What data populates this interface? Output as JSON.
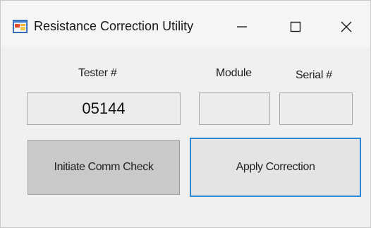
{
  "window": {
    "title": "Resistance Correction Utility",
    "icon": "app-form-icon",
    "controls": {
      "minimize_icon": "minimize-icon",
      "maximize_icon": "maximize-icon",
      "close_icon": "close-icon"
    }
  },
  "form": {
    "tester_label": "Tester #",
    "tester_value": "05144",
    "module_label": "Module",
    "module_value": "",
    "serial_label": "Serial #",
    "serial_value": ""
  },
  "buttons": {
    "initiate_comm_check": "Initiate Comm Check",
    "apply_correction": "Apply Correction"
  },
  "colors": {
    "window_background": "#f0f0f0",
    "focus_border": "#2f87d8",
    "disabled_button": "#c9c9c9"
  }
}
